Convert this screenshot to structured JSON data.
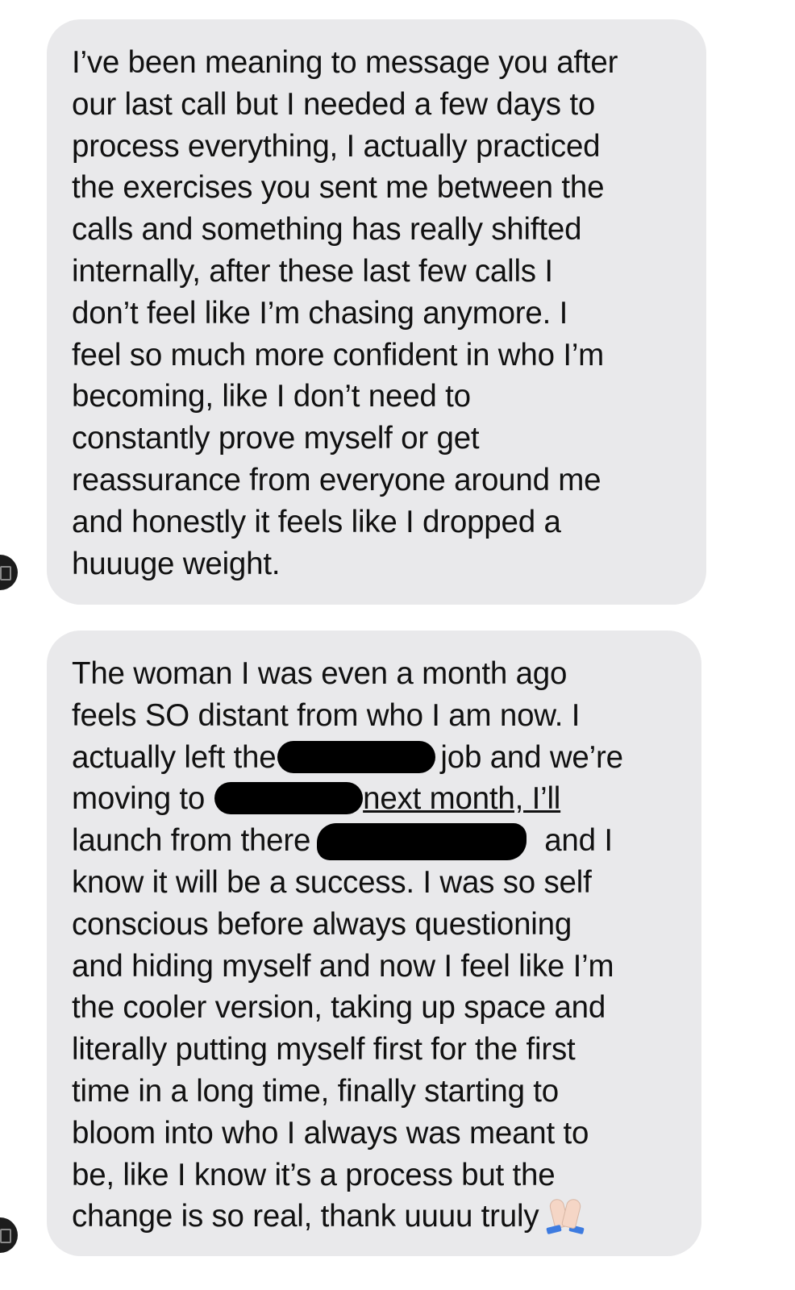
{
  "messages": [
    {
      "lines": [
        "I’ve been meaning to message you after",
        "our last call but I needed a few days to",
        "process everything, I actually practiced",
        "the exercises you sent me between the",
        "calls and something has really shifted",
        "internally, after these last few calls I",
        "don’t feel like I’m chasing anymore. I",
        "feel so much more confident in who I’m",
        "becoming, like I don’t need to",
        "constantly prove myself or get",
        "reassurance from everyone around me",
        "and honestly it feels like I dropped a",
        "huuuge weight."
      ]
    },
    {
      "line1": "The woman I was even a month ago",
      "line2": "feels SO distant from who I am now. I",
      "line3_pre": "actually left the",
      "line3_post": "job and we’re",
      "line4_pre": "moving to",
      "line4_post": "next month, I’ll",
      "line5_pre": "launch from there",
      "line5_post": "and I",
      "lines_rest": [
        "know it will be a success. I was so self",
        "conscious before always questioning",
        "and hiding myself and now I feel like I’m",
        "the cooler version, taking up space and",
        "literally putting myself first for the first",
        "time in a long time, finally starting to",
        "bloom into who I always was meant to",
        "be, like I know it’s a process but the"
      ],
      "last_line": "change is so real, thank uuuu truly",
      "emoji": "folded-hands-icon"
    }
  ]
}
